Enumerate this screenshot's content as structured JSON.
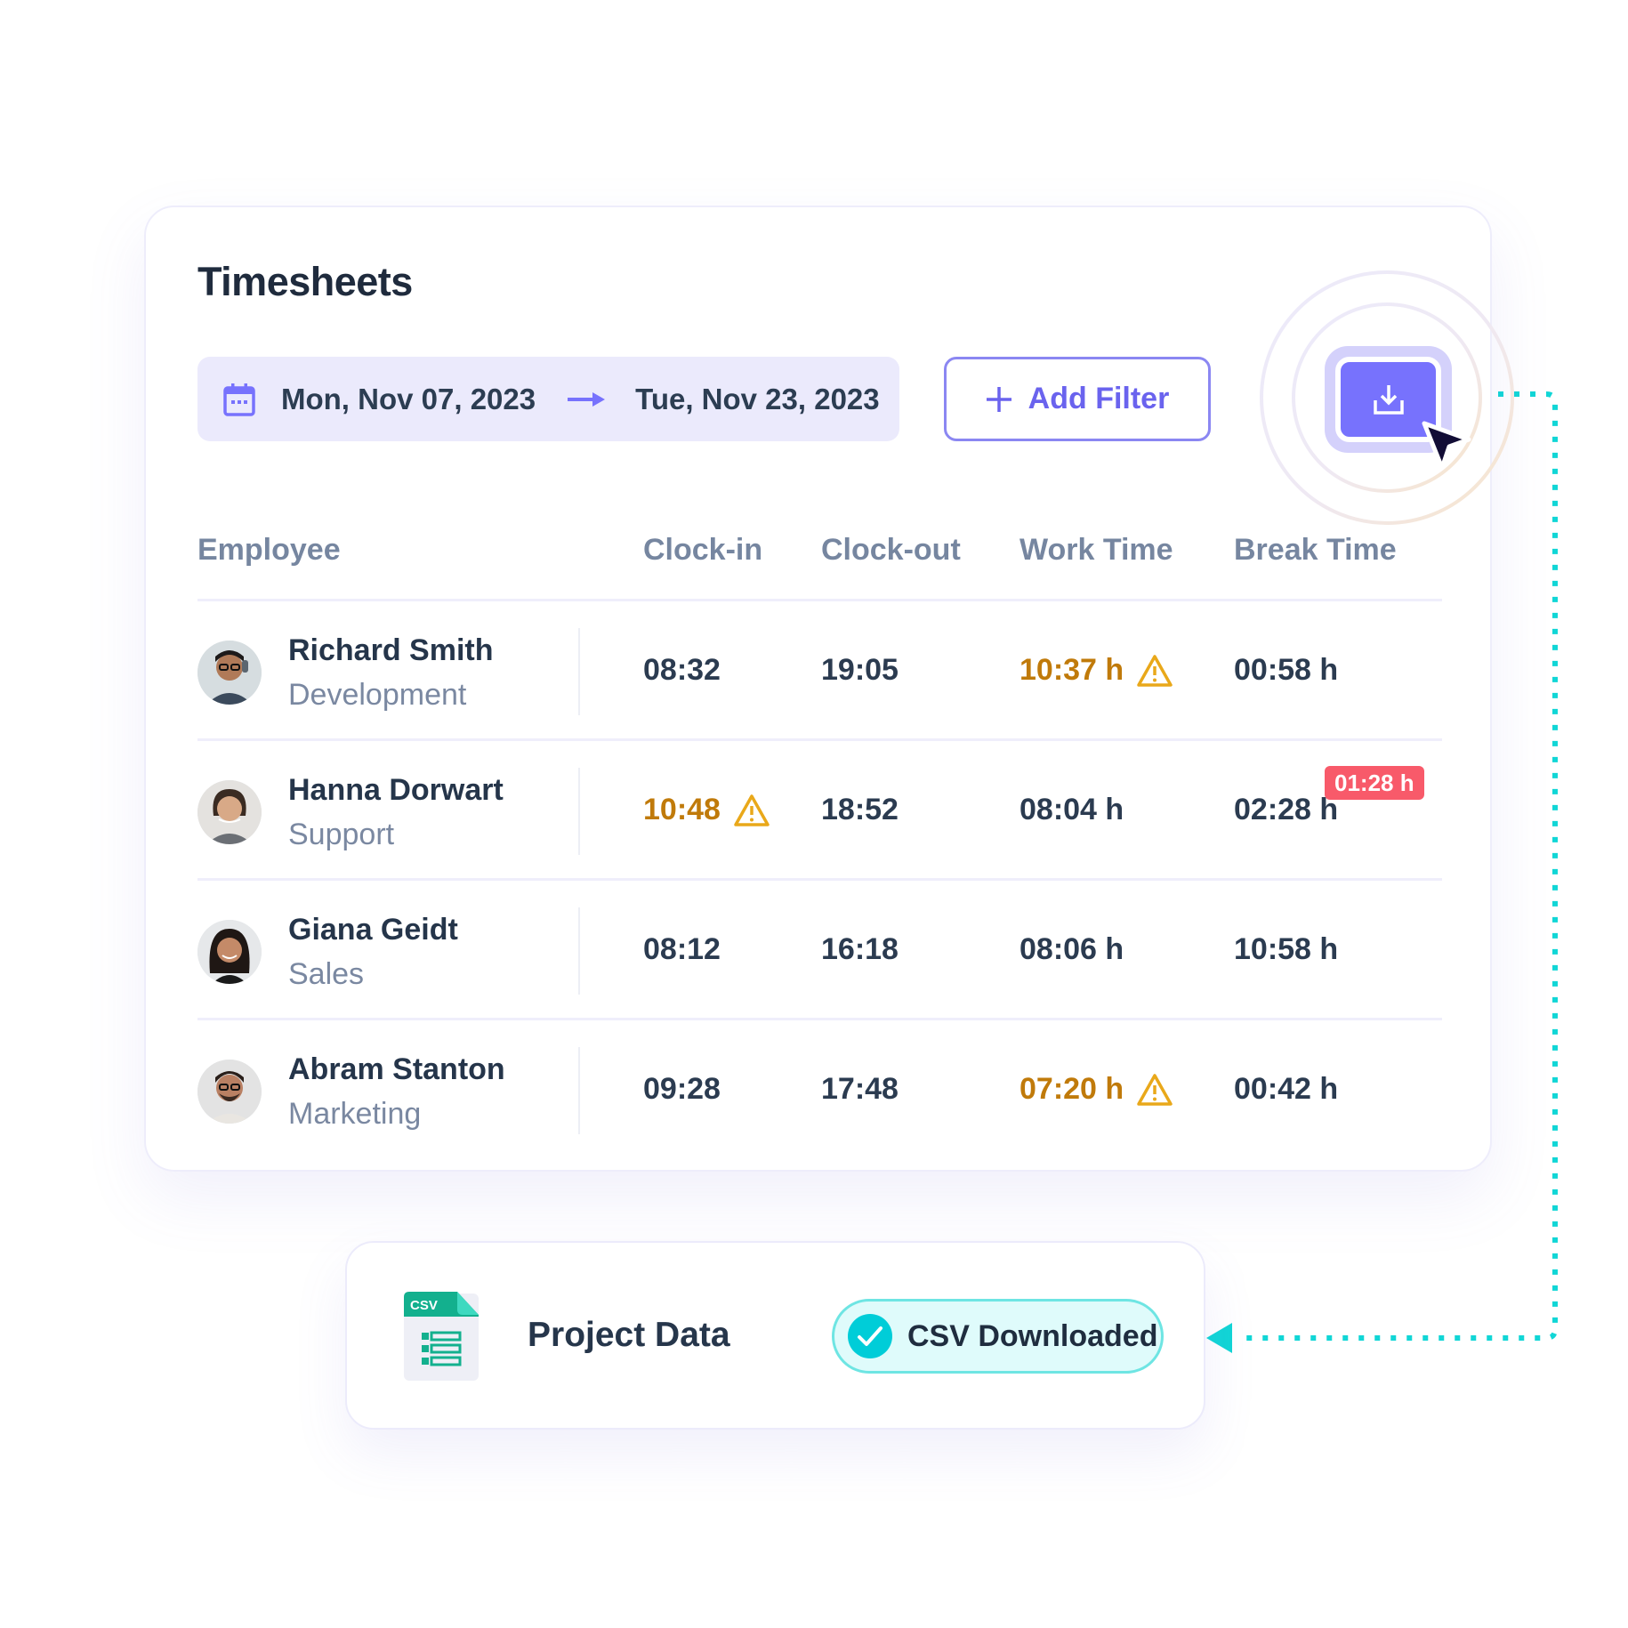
{
  "timesheets": {
    "title": "Timesheets",
    "date_range": {
      "start": "Mon, Nov 07, 2023",
      "end": "Tue, Nov 23, 2023",
      "icon": "calendar-icon",
      "separator_icon": "arrow-right-icon"
    },
    "add_filter": {
      "label": "Add Filter",
      "icon": "plus-icon"
    },
    "export": {
      "icon": "download-icon",
      "cursor_icon": "pointer-cursor-icon"
    },
    "columns": [
      "Employee",
      "Clock-in",
      "Clock-out",
      "Work Time",
      "Break Time"
    ],
    "rows": [
      {
        "name": "Richard Smith",
        "department": "Development",
        "clock_in": "08:32",
        "clock_out": "19:05",
        "work_time": "10:37 h",
        "break_time": "00:58 h",
        "clock_in_warning": false,
        "work_time_warning": true
      },
      {
        "name": "Hanna Dorwart",
        "department": "Support",
        "clock_in": "10:48",
        "clock_out": "18:52",
        "work_time": "08:04 h",
        "break_time": "02:28 h",
        "clock_in_warning": true,
        "work_time_warning": false,
        "break_overage": "01:28 h"
      },
      {
        "name": "Giana Geidt",
        "department": "Sales",
        "clock_in": "08:12",
        "clock_out": "16:18",
        "work_time": "08:06 h",
        "break_time": "10:58 h",
        "clock_in_warning": false,
        "work_time_warning": false
      },
      {
        "name": "Abram Stanton",
        "department": "Marketing",
        "clock_in": "09:28",
        "clock_out": "17:48",
        "work_time": "07:20 h",
        "break_time": "00:42 h",
        "clock_in_warning": false,
        "work_time_warning": true
      }
    ]
  },
  "export_result": {
    "file_badge": "CSV",
    "title": "Project Data",
    "status": "CSV Downloaded",
    "status_icon": "check-circle-icon"
  },
  "colors": {
    "accent": "#7772fd",
    "accent_light": "#ebeafc",
    "warning_text": "#c07a0a",
    "warning_icon": "#e9a81a",
    "danger": "#f85a6a",
    "teal": "#00d5d5",
    "csv_green": "#13b08e"
  }
}
